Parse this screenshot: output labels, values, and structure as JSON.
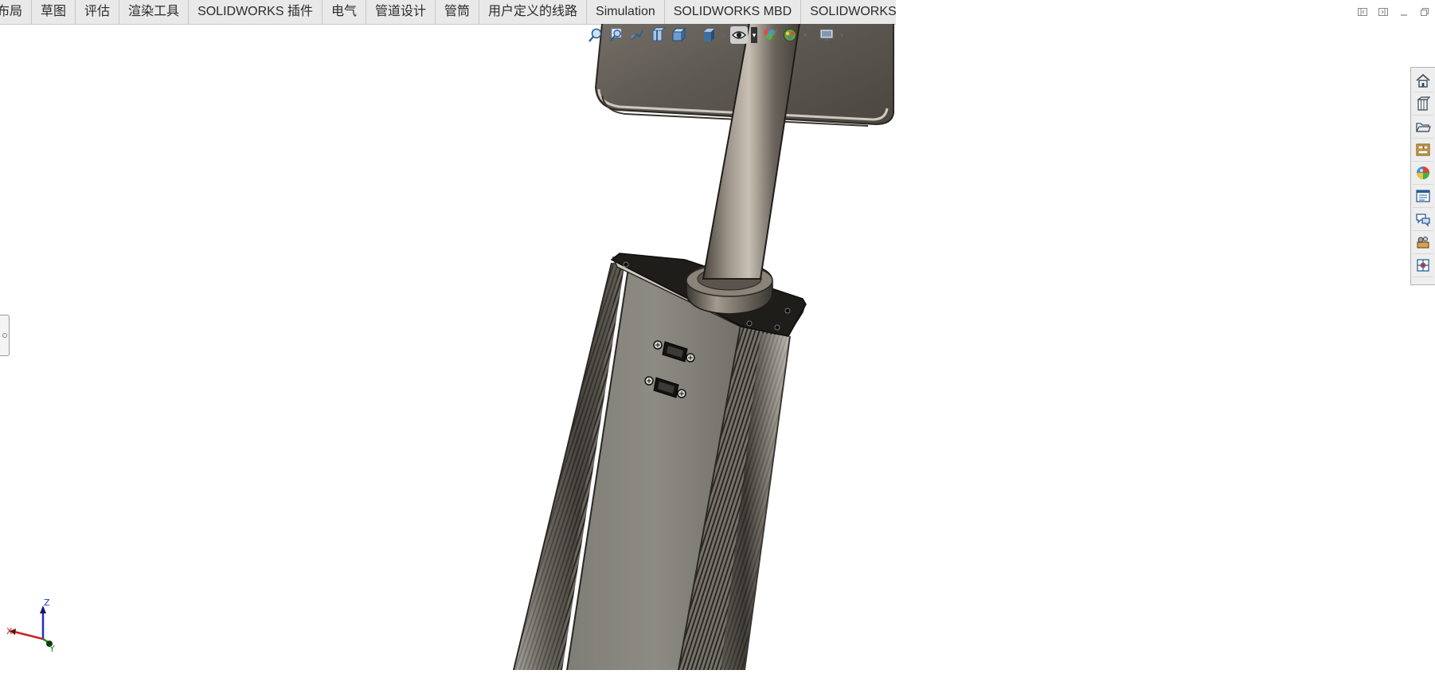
{
  "tabs": [
    {
      "label": "布局"
    },
    {
      "label": "草图"
    },
    {
      "label": "评估"
    },
    {
      "label": "渲染工具"
    },
    {
      "label": "SOLIDWORKS 插件"
    },
    {
      "label": "电气"
    },
    {
      "label": "管道设计"
    },
    {
      "label": "管筒"
    },
    {
      "label": "用户定义的线路"
    },
    {
      "label": "Simulation"
    },
    {
      "label": "SOLIDWORKS MBD"
    },
    {
      "label": "SOLIDWORKS CAM"
    }
  ],
  "window_controls": [
    "dock-left-icon",
    "dock-right-icon",
    "minimize-icon",
    "restore-icon"
  ],
  "view_toolbar": [
    "zoom-to-fit-icon",
    "zoom-to-area-icon",
    "previous-view-icon",
    "section-view-icon",
    "view-orientation-icon",
    "display-style-icon",
    "hide-show-items-icon",
    "edit-appearance-icon",
    "apply-scene-icon",
    "view-settings-icon"
  ],
  "task_pane": [
    "solidworks-resources-icon",
    "design-library-icon",
    "file-explorer-icon",
    "view-palette-icon",
    "appearances-scenes-icon",
    "custom-properties-icon",
    "forum-icon",
    "toolbox-icon",
    "3d-content-central-icon"
  ],
  "triad": {
    "x": "X",
    "y": "Y",
    "z": "Z"
  },
  "colors": {
    "tab_bg": "#e9e9e9",
    "x_axis": "#d02020",
    "y_axis": "#1a8a1a",
    "z_axis": "#2030c0"
  }
}
